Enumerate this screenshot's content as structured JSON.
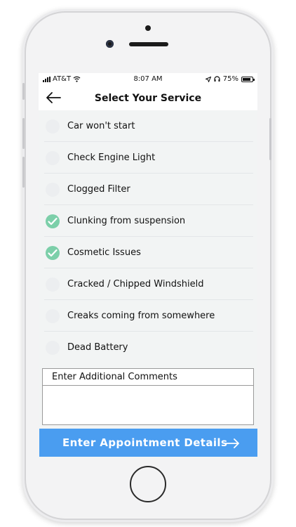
{
  "status_bar": {
    "carrier": "AT&T",
    "time": "8:07 AM",
    "battery": "75%",
    "battery_level": 0.75
  },
  "header": {
    "title": "Select Your Service",
    "back_icon": "back-arrow-icon"
  },
  "services": [
    {
      "label": "Car won't start",
      "checked": false
    },
    {
      "label": "Check Engine Light",
      "checked": false
    },
    {
      "label": "Clogged Filter",
      "checked": false
    },
    {
      "label": "Clunking from suspension",
      "checked": true
    },
    {
      "label": "Cosmetic Issues",
      "checked": true
    },
    {
      "label": "Cracked / Chipped Windshield",
      "checked": false
    },
    {
      "label": "Creaks coming from somewhere",
      "checked": false
    },
    {
      "label": "Dead Battery",
      "checked": false
    }
  ],
  "comments": {
    "label": "Enter Additional Comments",
    "value": ""
  },
  "cta": {
    "label": "Enter Appointment Details",
    "icon": "arrow-right-icon"
  },
  "colors": {
    "accent_blue": "#4a9df0",
    "check_green": "#7ccfa9"
  }
}
